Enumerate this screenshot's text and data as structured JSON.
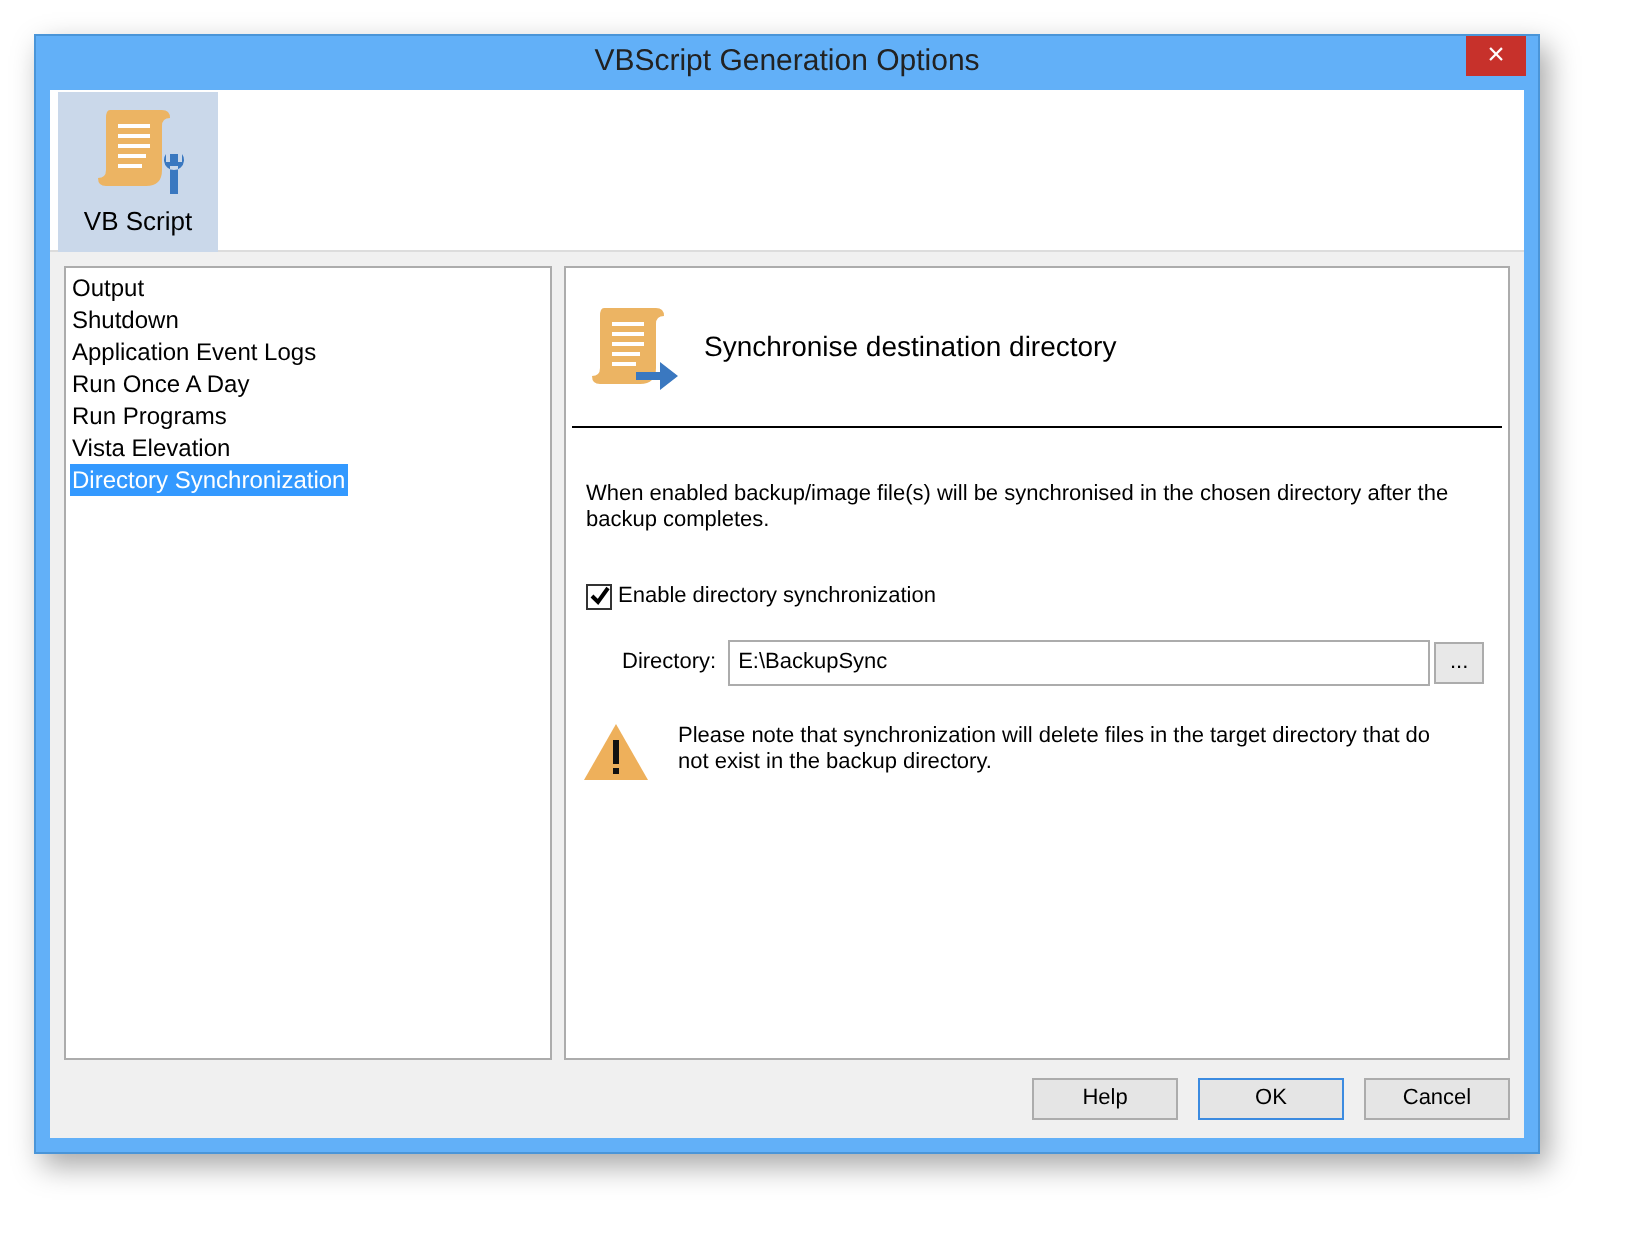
{
  "window": {
    "title": "VBScript Generation Options",
    "close": "×"
  },
  "toolbar": [
    {
      "label": "VB Script",
      "selected": true
    }
  ],
  "sidebar": {
    "items": [
      {
        "label": "Output",
        "selected": false
      },
      {
        "label": "Shutdown",
        "selected": false
      },
      {
        "label": "Application Event Logs",
        "selected": false
      },
      {
        "label": "Run Once A Day",
        "selected": false
      },
      {
        "label": "Run Programs",
        "selected": false
      },
      {
        "label": "Vista Elevation",
        "selected": false
      },
      {
        "label": "Directory Synchronization",
        "selected": true
      }
    ]
  },
  "panel": {
    "heading": "Synchronise destination directory",
    "description": "When enabled backup/image file(s) will be synchronised in the chosen directory after the backup completes.",
    "checkbox": {
      "label": "Enable directory synchronization",
      "checked": true
    },
    "directory": {
      "label": "Directory:",
      "value": "E:\\BackupSync",
      "browse": "..."
    },
    "warning": "Please note that synchronization will delete files in the target directory that do not exist in the backup directory."
  },
  "buttons": [
    {
      "label": "Help",
      "default": false
    },
    {
      "label": "OK",
      "default": true
    },
    {
      "label": "Cancel",
      "default": false
    }
  ]
}
